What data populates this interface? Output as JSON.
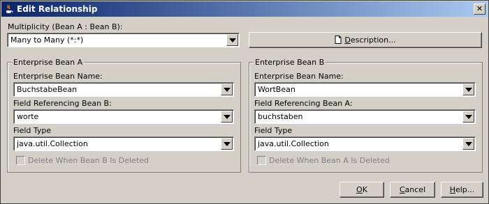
{
  "window": {
    "title": "Edit Relationship"
  },
  "multiplicity": {
    "label": "Multiplicity (Bean A : Bean B):",
    "value": "Many to Many (*:*)"
  },
  "description_button": {
    "label_pre": "",
    "label_ul": "D",
    "label_post": "escription..."
  },
  "bean_a": {
    "title": "Enterprise Bean A",
    "name_label": "Enterprise Bean Name:",
    "name_value": "BuchstabeBean",
    "field_label": "Field Referencing Bean B:",
    "field_value": "worte",
    "type_label": "Field Type",
    "type_value": "java.util.Collection",
    "delete_label": "Delete When Bean B Is Deleted"
  },
  "bean_b": {
    "title": "Enterprise Bean B",
    "name_label": "Enterprise Bean Name:",
    "name_value": "WortBean",
    "field_label": "Field Referencing Bean A:",
    "field_value": "buchstaben",
    "type_label": "Field Type",
    "type_value": "java.util.Collection",
    "delete_label": "Delete When Bean A Is Deleted"
  },
  "buttons": {
    "ok_ul": "O",
    "ok_rest": "K",
    "cancel_ul": "C",
    "cancel_rest": "ancel",
    "help_ul": "H",
    "help_rest": "elp..."
  }
}
